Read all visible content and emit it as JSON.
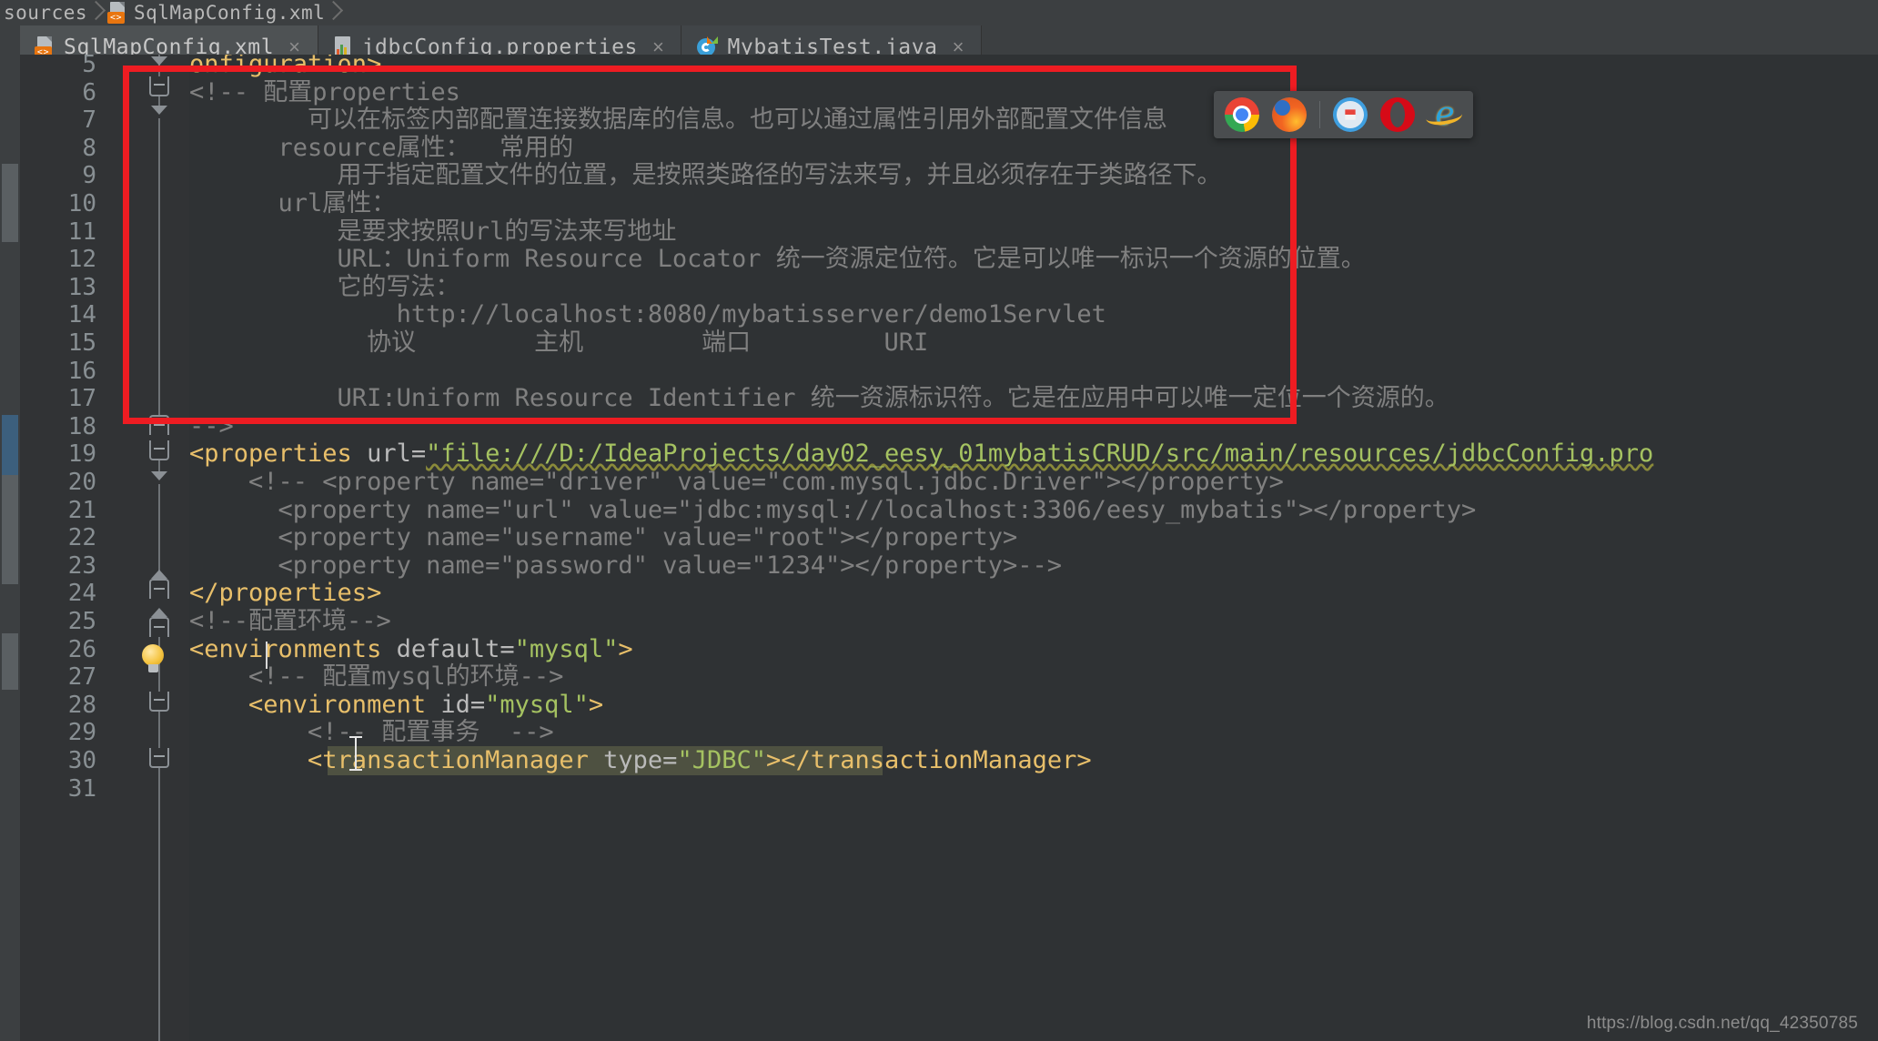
{
  "breadcrumb": {
    "items": [
      {
        "label": "sources",
        "icon": "none"
      },
      {
        "label": "SqlMapConfig.xml",
        "icon": "xml-file-icon"
      }
    ]
  },
  "tabs": [
    {
      "label": "SqlMapConfig.xml",
      "icon": "xml-file-icon",
      "active": true,
      "close": "×"
    },
    {
      "label": "jdbcConfig.properties",
      "icon": "properties-file-icon",
      "active": false,
      "close": "×"
    },
    {
      "label": "MybatisTest.java",
      "icon": "java-class-icon",
      "active": false,
      "close": "×"
    }
  ],
  "editor": {
    "line_numbers": [
      "5",
      "6",
      "7",
      "8",
      "9",
      "10",
      "11",
      "12",
      "13",
      "14",
      "15",
      "16",
      "17",
      "18",
      "19",
      "20",
      "21",
      "22",
      "23",
      "24",
      "25",
      "26",
      "27",
      "28",
      "29",
      "30",
      "31"
    ],
    "lines": [
      {
        "n": "5",
        "indent": 0,
        "segments": [
          {
            "t": "onfiguration>",
            "c": "tag"
          }
        ]
      },
      {
        "n": "6",
        "indent": 0,
        "segments": [
          {
            "t": "<!-- 配置properties",
            "c": "cmt"
          }
        ]
      },
      {
        "n": "7",
        "indent": 0,
        "segments": [
          {
            "t": "        可以在标签内部配置连接数据库的信息。也可以通过属性引用外部配置文件信息",
            "c": "cmt"
          }
        ]
      },
      {
        "n": "8",
        "indent": 0,
        "segments": [
          {
            "t": "      resource属性：  常用的",
            "c": "cmt"
          }
        ]
      },
      {
        "n": "9",
        "indent": 0,
        "segments": [
          {
            "t": "          用于指定配置文件的位置，是按照类路径的写法来写，并且必须存在于类路径下。",
            "c": "cmt"
          }
        ]
      },
      {
        "n": "10",
        "indent": 0,
        "segments": [
          {
            "t": "      url属性：",
            "c": "cmt"
          }
        ]
      },
      {
        "n": "11",
        "indent": 0,
        "segments": [
          {
            "t": "          是要求按照Url的写法来写地址",
            "c": "cmt"
          }
        ]
      },
      {
        "n": "12",
        "indent": 0,
        "segments": [
          {
            "t": "          URL：Uniform Resource Locator 统一资源定位符。它是可以唯一标识一个资源的位置。",
            "c": "cmt"
          }
        ]
      },
      {
        "n": "13",
        "indent": 0,
        "segments": [
          {
            "t": "          它的写法：",
            "c": "cmt"
          }
        ]
      },
      {
        "n": "14",
        "indent": 0,
        "segments": [
          {
            "t": "              http://localhost:8080/mybatisserver/demo1Servlet",
            "c": "cmt"
          }
        ]
      },
      {
        "n": "15",
        "indent": 0,
        "segments": [
          {
            "t": "            协议        主机        端口         URI",
            "c": "cmt"
          }
        ]
      },
      {
        "n": "16",
        "indent": 0,
        "segments": [
          {
            "t": "",
            "c": "cmt"
          }
        ]
      },
      {
        "n": "17",
        "indent": 0,
        "segments": [
          {
            "t": "          URI:Uniform Resource Identifier 统一资源标识符。它是在应用中可以唯一定位一个资源的。",
            "c": "cmt"
          }
        ]
      },
      {
        "n": "18",
        "indent": 0,
        "segments": [
          {
            "t": "-->",
            "c": "cmt"
          }
        ]
      },
      {
        "n": "19",
        "indent": 0,
        "segments": [
          {
            "t": "<properties ",
            "c": "tag"
          },
          {
            "t": "url=",
            "c": "attr"
          },
          {
            "t": "\"file:///D:/IdeaProjects/day02_eesy_01mybatisCRUD/src/main/resources/jdbcConfig.pro",
            "c": "str"
          }
        ]
      },
      {
        "n": "20",
        "indent": 0,
        "segments": [
          {
            "t": "    <!-- <property name=\"driver\" value=\"com.mysql.jdbc.Driver\"></property>",
            "c": "cmt"
          }
        ]
      },
      {
        "n": "21",
        "indent": 0,
        "segments": [
          {
            "t": "      <property name=\"url\" value=\"jdbc:mysql://localhost:3306/eesy_mybatis\"></property>",
            "c": "cmt"
          }
        ]
      },
      {
        "n": "22",
        "indent": 0,
        "segments": [
          {
            "t": "      <property name=\"username\" value=\"root\"></property>",
            "c": "cmt"
          }
        ]
      },
      {
        "n": "23",
        "indent": 0,
        "segments": [
          {
            "t": "      <property name=\"password\" value=\"1234\"></property>-->",
            "c": "cmt"
          }
        ]
      },
      {
        "n": "24",
        "indent": 0,
        "segments": [
          {
            "t": "</properties>",
            "c": "tag"
          }
        ]
      },
      {
        "n": "25",
        "indent": 0,
        "segments": [
          {
            "t": "<!--配置环境-->",
            "c": "cmt"
          }
        ]
      },
      {
        "n": "26",
        "indent": 0,
        "segments": [
          {
            "t": "<environments ",
            "c": "tag"
          },
          {
            "t": "default=",
            "c": "attr"
          },
          {
            "t": "\"mysql\"",
            "c": "str"
          },
          {
            "t": ">",
            "c": "tag"
          }
        ]
      },
      {
        "n": "27",
        "indent": 0,
        "segments": [
          {
            "t": "    <!-- 配置mysql的环境-->",
            "c": "cmt"
          }
        ]
      },
      {
        "n": "28",
        "indent": 0,
        "segments": [
          {
            "t": "    <environment ",
            "c": "tag"
          },
          {
            "t": "id=",
            "c": "attr"
          },
          {
            "t": "\"mysql\"",
            "c": "str"
          },
          {
            "t": ">",
            "c": "tag"
          }
        ]
      },
      {
        "n": "29",
        "indent": 0,
        "segments": [
          {
            "t": "        <!-- 配置事务  -->",
            "c": "cmt"
          }
        ]
      },
      {
        "n": "30",
        "indent": 0,
        "segments": [
          {
            "t": "        <transactionManager ",
            "c": "tag"
          },
          {
            "t": "type=",
            "c": "attr"
          },
          {
            "t": "\"JDBC\"",
            "c": "str"
          },
          {
            "t": "></transactionManager>",
            "c": "tag"
          }
        ]
      },
      {
        "n": "31",
        "indent": 0,
        "segments": [
          {
            "t": "",
            "c": "cmt"
          }
        ]
      }
    ]
  },
  "browser_popup": {
    "browsers": [
      {
        "name": "chrome-icon"
      },
      {
        "name": "firefox-icon"
      },
      {
        "name": "safari-icon"
      },
      {
        "name": "opera-icon"
      },
      {
        "name": "internet-explorer-icon"
      }
    ]
  },
  "annotation": {
    "color": "#ee1c22",
    "label": "red-highlight-box"
  },
  "watermark": "https://blog.csdn.net/qq_42350785",
  "colors": {
    "background": "#2f3234",
    "gutter": "#313335",
    "tabbar": "#3c3f41",
    "tab_active_underline": "#4ba7d8",
    "comment": "#808080",
    "tag": "#e8bf6a",
    "string": "#a5c261",
    "attribute": "#bababa",
    "default_text": "#a9b7c6",
    "selection": "#4e5141",
    "annotation_red": "#ee1c22"
  }
}
